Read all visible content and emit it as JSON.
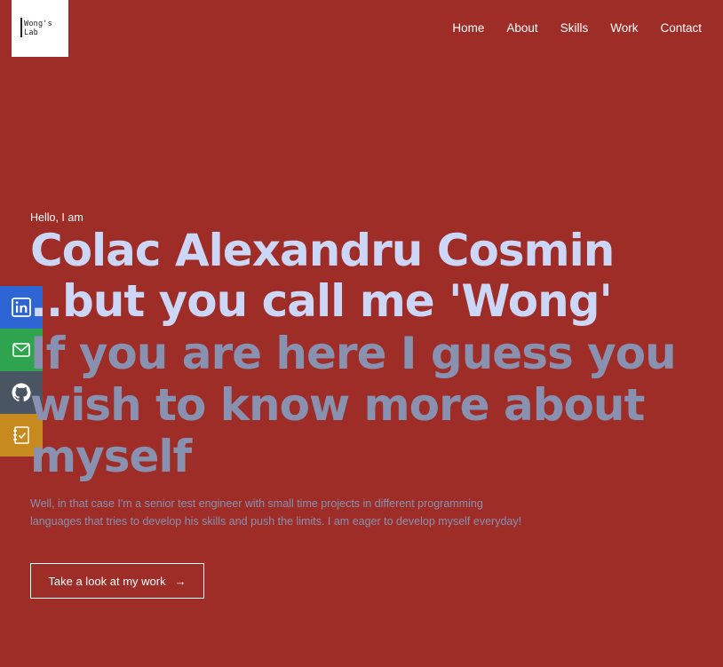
{
  "logo": {
    "line1": "Wong's",
    "line2": "Lab"
  },
  "nav": {
    "items": [
      "Home",
      "About",
      "Skills",
      "Work",
      "Contact"
    ]
  },
  "social": [
    {
      "icon": "linkedin-icon",
      "color": "#2d65d4"
    },
    {
      "icon": "mail-icon",
      "color": "#2ea44f"
    },
    {
      "icon": "github-icon",
      "color": "#4a5563"
    },
    {
      "icon": "notebook-icon",
      "color": "#c68a1e"
    }
  ],
  "hero": {
    "greeting": "Hello, I am",
    "name": "Colac Alexandru Cosmin",
    "nickname": "..but you call me 'Wong'",
    "tagline": "If you are here I guess you wish to know more about myself",
    "description": "Well, in that case I'm a senior test engineer with small time projects in different programming languages that tries to develop his skills and push the limits. I am eager to develop myself everyday!",
    "cta_label": "Take a look at my work",
    "cta_arrow": "→"
  },
  "colors": {
    "background": "#9e2c27",
    "heading": "#ccd6f6",
    "muted": "#8892b0"
  }
}
